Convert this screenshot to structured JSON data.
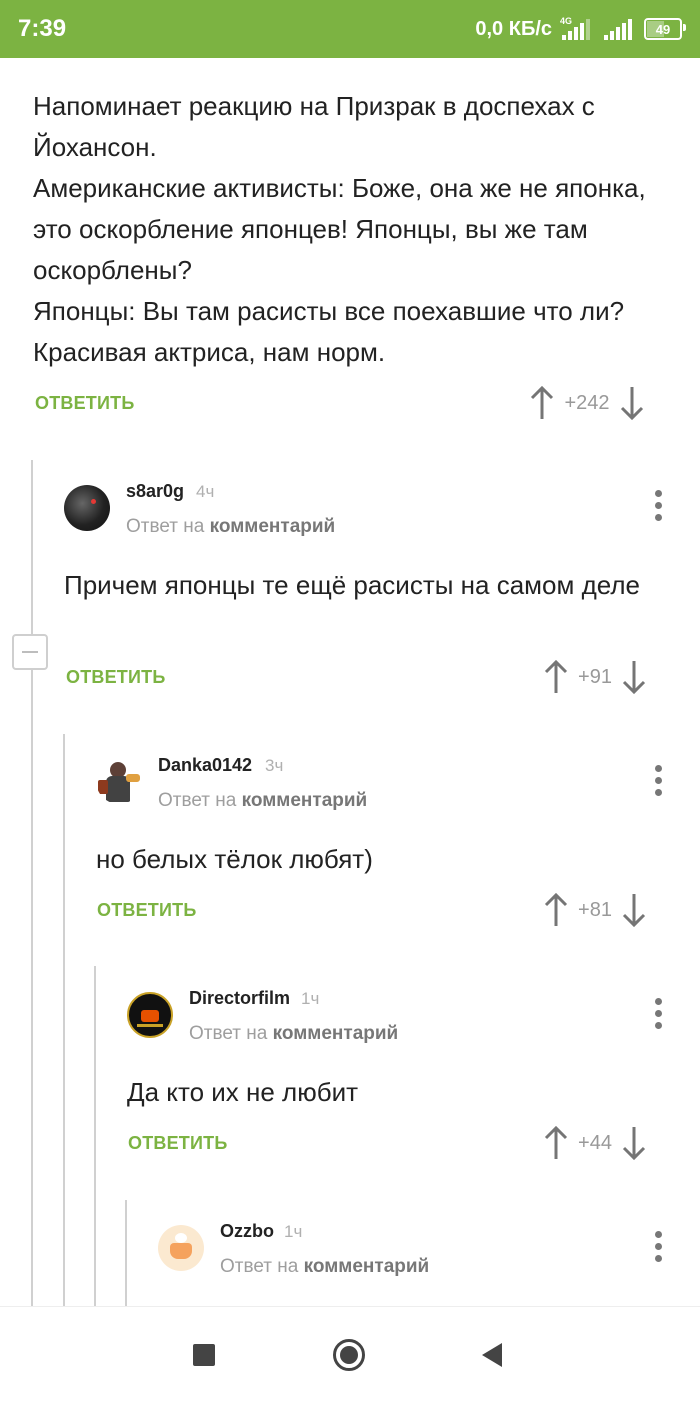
{
  "status_bar": {
    "time": "7:39",
    "network_speed": "0,0 КБ/с",
    "network_type": "4G",
    "battery": "49",
    "battery_level": 0.49,
    "bg_color": "#7cb342"
  },
  "post": {
    "text": "Напоминает реакцию на Призрак в доспехах  с Йохансон.\nАмериканские активисты: Боже, она же не японка, это оскорбление японцев! Японцы, вы же там оскорблены?\nЯпонцы: Вы там расисты все поехавшие что ли? Красивая актриса, нам норм.",
    "reply_label": "ОТВЕТИТЬ",
    "score": "+242"
  },
  "comments": [
    {
      "author": "s8ar0g",
      "time": "4ч",
      "reply_prefix": "Ответ на",
      "reply_target": "комментарий",
      "text": "Причем японцы те ещё расисты на самом деле",
      "reply_label": "ОТВЕТИТЬ",
      "score": "+91"
    },
    {
      "author": "Danka0142",
      "time": "3ч",
      "reply_prefix": "Ответ на",
      "reply_target": "комментарий",
      "text": "но белых тёлок любят)",
      "reply_label": "ОТВЕТИТЬ",
      "score": "+81"
    },
    {
      "author": "Directorfilm",
      "time": "1ч",
      "reply_prefix": "Ответ на",
      "reply_target": "комментарий",
      "text": "Да кто их не любит",
      "reply_label": "ОТВЕТИТЬ",
      "score": "+44"
    },
    {
      "author": "Ozzbo",
      "time": "1ч",
      "reply_prefix": "Ответ на",
      "reply_target": "комментарий"
    }
  ],
  "colors": {
    "accent": "#7cb342",
    "text": "#222222",
    "muted": "#9e9e9e",
    "thread_line": "#d0d0d0"
  },
  "icons": {
    "vote_up": "arrow-up-icon",
    "vote_down": "arrow-down-icon",
    "more": "more-vertical-icon",
    "collapse": "collapse-minus-icon",
    "nav_recents": "square-icon",
    "nav_home": "home-circle-icon",
    "nav_back": "back-triangle-icon"
  }
}
